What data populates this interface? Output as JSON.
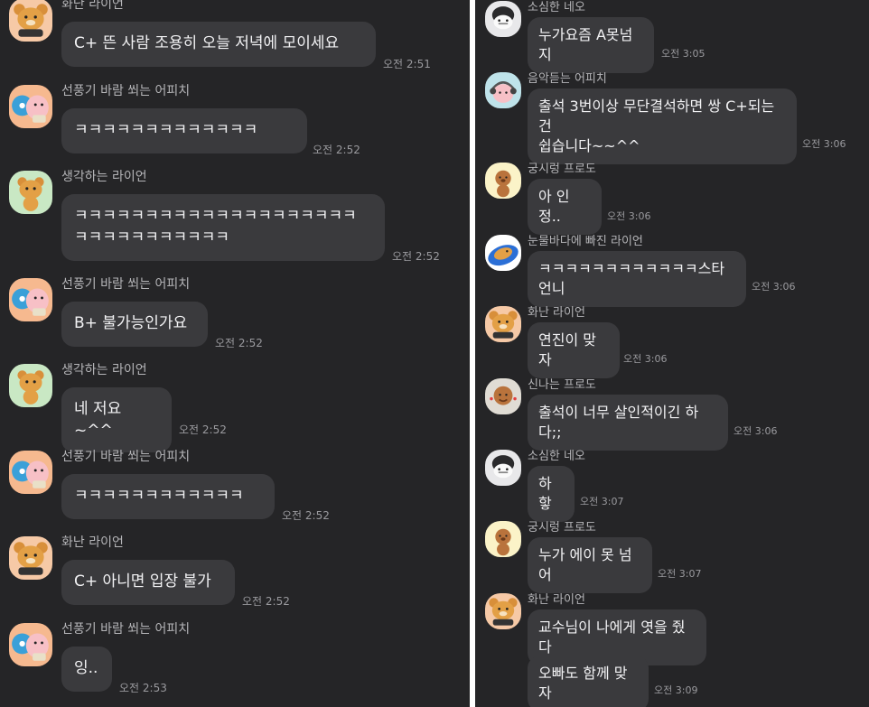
{
  "left": {
    "messages": [
      {
        "sender": "화난 라이언",
        "text": "C+ 뜬 사람 조용히 오늘 저녁에 모이세요",
        "time": "오전 2:51",
        "avatar": "angry-ryan-avatar-icon"
      },
      {
        "sender": "선풍기 바람 쐬는 어피치",
        "text": "ㅋㅋㅋㅋㅋㅋㅋㅋㅋㅋㅋㅋㅋ",
        "time": "오전 2:52",
        "avatar": "fan-apeach-avatar-icon"
      },
      {
        "sender": "생각하는 라이언",
        "text": "ㅋㅋㅋㅋㅋㅋㅋㅋㅋㅋㅋㅋㅋㅋㅋㅋㅋㅋㅋㅋ\nㅋㅋㅋㅋㅋㅋㅋㅋㅋㅋㅋ",
        "time": "오전 2:52",
        "avatar": "thinking-ryan-avatar-icon"
      },
      {
        "sender": "선풍기 바람 쐬는 어피치",
        "text": "B+ 불가능인가요",
        "time": "오전 2:52",
        "avatar": "fan-apeach-avatar-icon"
      },
      {
        "sender": "생각하는 라이언",
        "text": "네 저요~^^",
        "time": "오전 2:52",
        "avatar": "thinking-ryan-avatar-icon"
      },
      {
        "sender": "선풍기 바람 쐬는 어피치",
        "text": "ㅋㅋㅋㅋㅋㅋㅋㅋㅋㅋㅋㅋ",
        "time": "오전 2:52",
        "avatar": "fan-apeach-avatar-icon"
      },
      {
        "sender": "화난 라이언",
        "text": "C+ 아니면 입장 불가",
        "time": "오전 2:52",
        "avatar": "angry-ryan-avatar-icon"
      },
      {
        "sender": "선풍기 바람 쐬는 어피치",
        "text": "잉..",
        "time": "오전 2:53",
        "avatar": "fan-apeach-avatar-icon"
      }
    ]
  },
  "right": {
    "messages": [
      {
        "sender": "소심한 네오",
        "text": "누가요즘 A못넘지",
        "time": "오전 3:05",
        "avatar": "shy-neo-avatar-icon"
      },
      {
        "sender": "음악듣는 어피치",
        "text": "출석 3번이상 무단결석하면 쌍 C+되는건\n쉽습니다~~^^",
        "time": "오전 3:06",
        "avatar": "music-apeach-avatar-icon"
      },
      {
        "sender": "궁시렁 프로도",
        "text": "아 인정..",
        "time": "오전 3:06",
        "avatar": "grumbling-frodo-avatar-icon"
      },
      {
        "sender": "눈물바다에 빠진 라이언",
        "text": "ㅋㅋㅋㅋㅋㅋㅋㅋㅋㅋㅋㅋ스타언니",
        "time": "오전 3:06",
        "avatar": "crying-ryan-avatar-icon"
      },
      {
        "sender": "화난 라이언",
        "text": "연진이 맞자",
        "time": "오전 3:06",
        "avatar": "angry-ryan-avatar-icon"
      },
      {
        "sender": "신나는 프로도",
        "text": "출석이 너무 살인적이긴 하다;;",
        "time": "오전 3:06",
        "avatar": "excited-frodo-avatar-icon"
      },
      {
        "sender": "소심한 네오",
        "text": "하핳",
        "time": "오전 3:07",
        "avatar": "shy-neo-avatar-icon"
      },
      {
        "sender": "궁시렁 프로도",
        "text": "누가 에이 못 넘어",
        "time": "오전 3:07",
        "avatar": "grumbling-frodo-avatar-icon"
      },
      {
        "sender": "화난 라이언",
        "text": "교수님이 나에게 엿을 줬다",
        "time": "",
        "avatar": "angry-ryan-avatar-icon"
      },
      {
        "sender": "",
        "text": "오빠도 함께 맞자",
        "time": "오전 3:09",
        "avatar": ""
      }
    ]
  },
  "colors": {
    "background": "#252527",
    "bubble": "#3a3a3d",
    "text": "#f2f2f4",
    "name": "#b5b5b8",
    "time": "#9a9a9e"
  }
}
